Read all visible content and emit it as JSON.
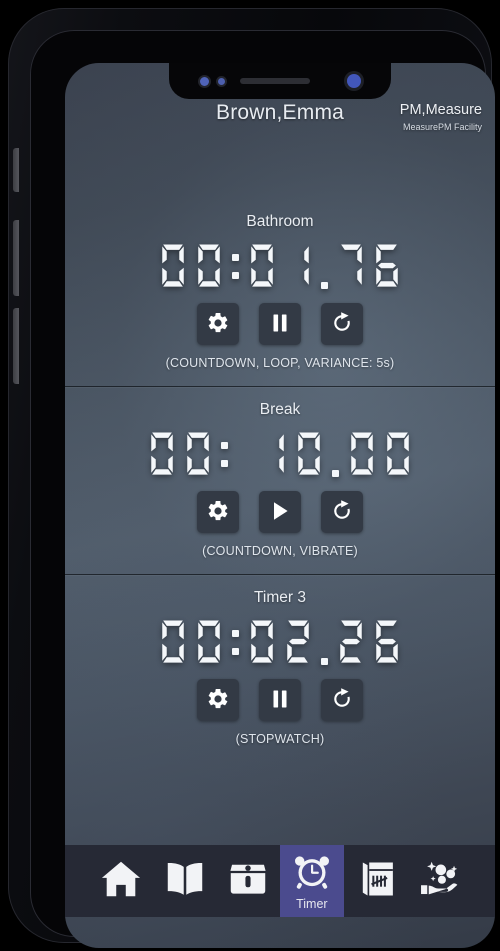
{
  "header": {
    "patient_name": "Brown,Emma",
    "staff_name": "PM,Measure",
    "facility": "MeasurePM Facility"
  },
  "timers": [
    {
      "label": "Bathroom",
      "display": "00:01.76",
      "meta": "(COUNTDOWN, LOOP, VARIANCE: 5s)",
      "settings_label": "Settings",
      "toggle_icon": "pause-icon",
      "toggle_label": "Pause",
      "reset_label": "Reset"
    },
    {
      "label": "Break",
      "display": "00: 10.00",
      "meta": "(COUNTDOWN, VIBRATE)",
      "settings_label": "Settings",
      "toggle_icon": "play-icon",
      "toggle_label": "Start",
      "reset_label": "Reset"
    },
    {
      "label": "Timer 3",
      "display": "00:02.26",
      "meta": "(STOPWATCH)",
      "settings_label": "Settings",
      "toggle_icon": "pause-icon",
      "toggle_label": "Pause",
      "reset_label": "Reset"
    }
  ],
  "nav": {
    "items": [
      {
        "icon": "home-icon",
        "label": "",
        "active": false
      },
      {
        "icon": "book-icon",
        "label": "",
        "active": false
      },
      {
        "icon": "treasure-icon",
        "label": "",
        "active": false
      },
      {
        "icon": "alarm-clock-icon",
        "label": "Timer",
        "active": true
      },
      {
        "icon": "tally-chart-icon",
        "label": "",
        "active": false
      },
      {
        "icon": "hand-coins-icon",
        "label": "",
        "active": false
      }
    ]
  },
  "colors": {
    "accent_active_tab": "#4b4b8e",
    "nav_background": "#262935",
    "button_face": "#333a45",
    "digit_color": "#f4f7fa",
    "screen_top": "#3b424f",
    "screen_mid": "#515d6b"
  },
  "device": {
    "notch": [
      "sensor-dot",
      "sensor-dot",
      "speaker-grille",
      "front-camera"
    ]
  }
}
